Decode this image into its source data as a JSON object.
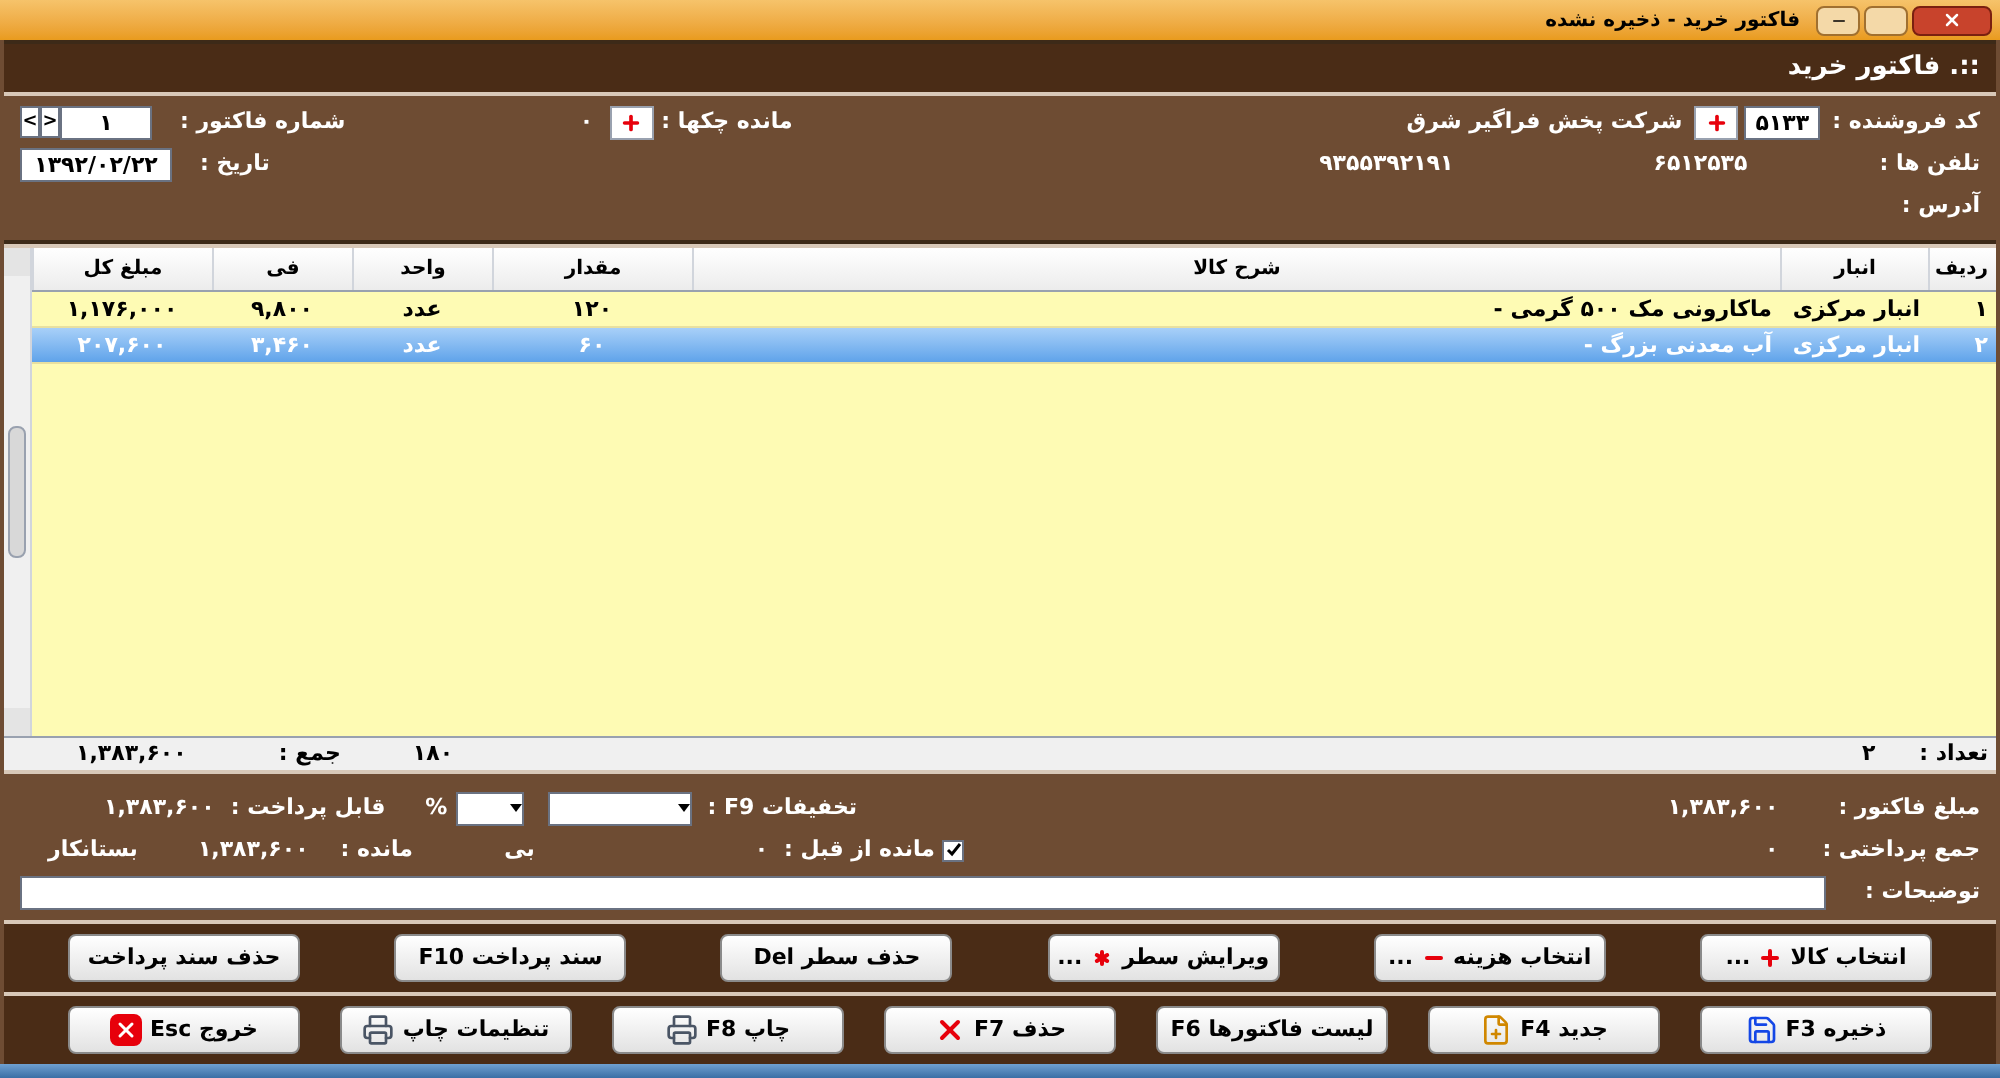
{
  "window": {
    "title": "فاکتور خرید - ذخیره نشده"
  },
  "header": {
    "title": "::. فاکتور خرید"
  },
  "info": {
    "seller_code_label": "کد فروشنده :",
    "seller_code": "۵۱۳۳",
    "seller_name": "شرکت  پخش فراگیر شرق",
    "cheques_label": "مانده چکها :",
    "cheques_value": "۰",
    "invoice_no_label": "شماره فاکتور :",
    "invoice_no": "۱",
    "prev": "<",
    "next": ">",
    "phones_label": "تلفن ها :",
    "phone_1": "۶۵۱۲۵۳۵",
    "phone_2": "۹۳۵۵۳۹۲۱۹۱",
    "date_label": "تاریخ :",
    "date": "۱۳۹۲/۰۲/۲۲",
    "address_label": "آدرس :"
  },
  "table": {
    "columns": [
      "ردیف",
      "انبار",
      "شرح کالا",
      "مقدار",
      "واحد",
      "فی",
      "مبلغ کل"
    ],
    "rows": [
      {
        "cells": [
          "۱",
          "انبار مرکزی",
          "ماکارونی مک ۵۰۰ گرمی -",
          "۱۲۰",
          "عدد",
          "۹,۸۰۰",
          "۱,۱۷۶,۰۰۰"
        ],
        "selected": false
      },
      {
        "cells": [
          "۲",
          "انبار مرکزی",
          "آب معدنی بزرگ -",
          "۶۰",
          "عدد",
          "۳,۴۶۰",
          "۲۰۷,۶۰۰"
        ],
        "selected": true
      }
    ],
    "footer": {
      "count_label": "تعداد :",
      "count": "۲",
      "qty_total": "۱۸۰",
      "sum_label": "جمع :",
      "sum": "۱,۳۸۳,۶۰۰"
    }
  },
  "totals": {
    "invoice_amount_label": "مبلغ فاکتور :",
    "invoice_amount": "۱,۳۸۳,۶۰۰",
    "discounts_label": "تخفیفات F9 :",
    "percent": "%",
    "payable_label": "قابل پرداخت :",
    "payable": "۱,۳۸۳,۶۰۰",
    "paid_label": "جمع پرداختی :",
    "paid": "۰",
    "prev_balance_label": "مانده از قبل :",
    "prev_balance_checked": true,
    "prev_balance": "۰",
    "status": "بی",
    "balance_label": "مانده :",
    "balance": "۱,۳۸۳,۶۰۰",
    "balance_type": "بستانکار",
    "notes_label": "توضیحات :"
  },
  "action_buttons": [
    {
      "label": "انتخاب کالا",
      "kind": "plus",
      "suffix": "..."
    },
    {
      "label": "انتخاب هزینه",
      "kind": "minus",
      "suffix": "..."
    },
    {
      "label": "ویرایش سطر",
      "kind": "star",
      "suffix": "..."
    },
    {
      "label": "حذف سطر Del",
      "kind": "plain"
    },
    {
      "label": "سند پرداخت F10",
      "kind": "plain"
    },
    {
      "label": "حذف سند پرداخت",
      "kind": "plain"
    }
  ],
  "command_buttons": [
    {
      "label": "ذخیره F3",
      "kind": "save"
    },
    {
      "label": "جدید F4",
      "kind": "new"
    },
    {
      "label": "لیست فاکتورها F6",
      "kind": "plain"
    },
    {
      "label": "حذف F7",
      "kind": "delete"
    },
    {
      "label": "چاپ F8",
      "kind": "print"
    },
    {
      "label": "تنظیمات چاپ",
      "kind": "print"
    },
    {
      "label": "خروج Esc",
      "kind": "exit"
    }
  ]
}
